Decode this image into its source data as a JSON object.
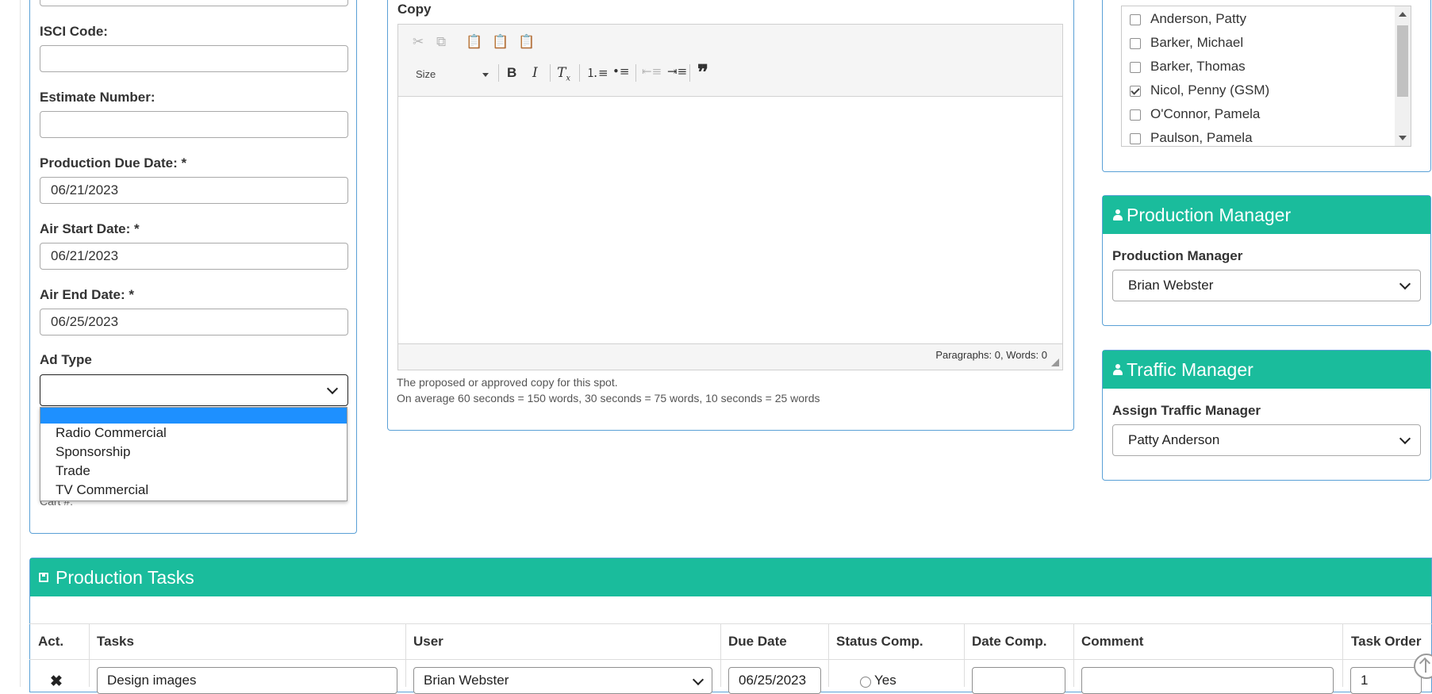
{
  "left_form": {
    "isci_label": "ISCI Code:",
    "isci_value": "",
    "estimate_label": "Estimate Number:",
    "estimate_value": "",
    "production_due_label": "Production Due Date: *",
    "production_due_value": "06/21/2023",
    "air_start_label": "Air Start Date: *",
    "air_start_value": "06/21/2023",
    "air_end_label": "Air End Date: *",
    "air_end_value": "06/25/2023",
    "ad_type_label": "Ad Type",
    "ad_type_value": "",
    "ad_type_options": [
      "",
      "Radio Commercial",
      "Sponsorship",
      "Trade",
      "TV Commercial"
    ],
    "cart_label": "Cart #:"
  },
  "copy": {
    "label": "Copy",
    "size_label": "Size",
    "footer_status": "Paragraphs: 0, Words: 0",
    "help_line1": "The proposed or approved copy for this spot.",
    "help_line2": "On average 60 seconds = 150 words, 30 seconds = 75 words, 10 seconds = 25 words"
  },
  "users": {
    "items": [
      {
        "name": "Anderson, Patty",
        "checked": false
      },
      {
        "name": "Barker, Michael",
        "checked": false
      },
      {
        "name": "Barker, Thomas",
        "checked": false
      },
      {
        "name": "Nicol, Penny (GSM)",
        "checked": true
      },
      {
        "name": "O'Connor, Pamela",
        "checked": false
      },
      {
        "name": "Paulson, Pamela",
        "checked": false
      }
    ]
  },
  "production_manager": {
    "header": "Production Manager",
    "label": "Production Manager",
    "value": "Brian Webster"
  },
  "traffic_manager": {
    "header": "Traffic Manager",
    "label": "Assign Traffic Manager",
    "value": "Patty Anderson"
  },
  "tasks": {
    "header": "Production Tasks",
    "columns": [
      "Act.",
      "Tasks",
      "User",
      "Due Date",
      "Status Comp.",
      "Date Comp.",
      "Comment",
      "Task Order"
    ],
    "rows": [
      {
        "task": "Design images",
        "user": "Brian Webster",
        "due_date": "06/25/2023",
        "status_label": "Yes",
        "date_comp": "",
        "comment": "",
        "order": "1"
      }
    ]
  },
  "colors": {
    "accent": "#1abc9c",
    "panel_border": "#5aa0d6",
    "selection": "#1e90ff"
  }
}
